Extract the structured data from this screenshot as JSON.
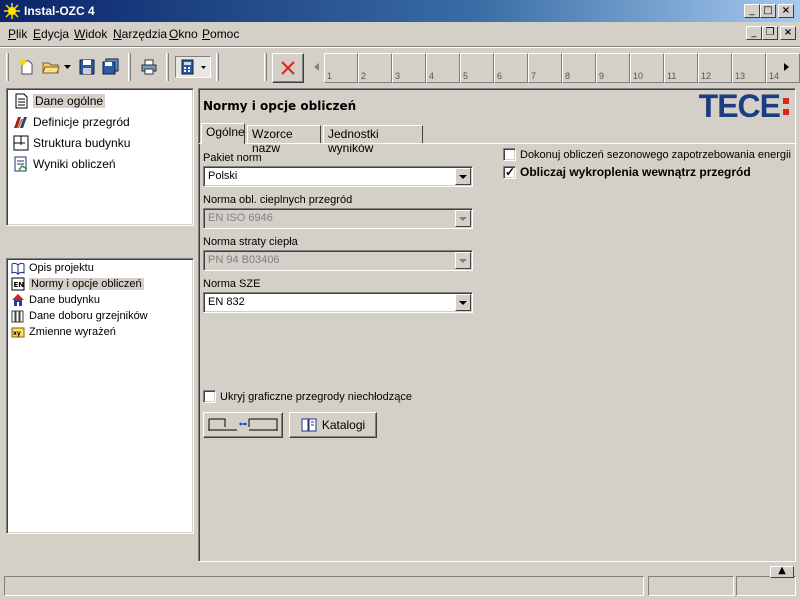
{
  "window": {
    "title": "Instal-OZC 4"
  },
  "menu": {
    "items": [
      {
        "label": "Plik",
        "key": "P",
        "rest": "lik"
      },
      {
        "label": "Edycja",
        "key": "E",
        "rest": "dycja"
      },
      {
        "label": "Widok",
        "key": "W",
        "rest": "idok"
      },
      {
        "label": "Narzędzia",
        "key": "N",
        "rest": "arzędzia"
      },
      {
        "label": "Okno",
        "key": "O",
        "rest": "kno"
      },
      {
        "label": "Pomoc",
        "key": "P",
        "rest": "omoc"
      }
    ]
  },
  "toolbar": {
    "strip_numbers": [
      "1",
      "2",
      "3",
      "4",
      "5",
      "6",
      "7",
      "8",
      "9",
      "10",
      "11",
      "12",
      "13",
      "14"
    ]
  },
  "nav_top": {
    "items": [
      "Dane ogólne",
      "Definicje przegród",
      "Struktura budynku",
      "Wyniki obliczeń"
    ]
  },
  "nav_bottom": {
    "items": [
      "Opis projektu",
      "Normy i opcje obliczeń",
      "Dane budynku",
      "Dane doboru grzejników",
      "Zmienne wyrażeń"
    ]
  },
  "panel": {
    "title": "Normy i opcje obliczeń",
    "logo": "TECE",
    "tabs": [
      "Ogólne",
      "Wzorce nazw",
      "Jednostki wyników"
    ],
    "fields": [
      {
        "label": "Pakiet norm",
        "value": "Polski",
        "disabled": false
      },
      {
        "label": "Norma obl. cieplnych przegród",
        "value": "EN ISO 6946",
        "disabled": true
      },
      {
        "label": "Norma straty ciepła",
        "value": "PN 94 B03406",
        "disabled": true
      },
      {
        "label": "Norma SZE",
        "value": "EN 832",
        "disabled": false
      }
    ],
    "checkbox_seasonal": {
      "label": "Dokonuj obliczeń sezonowego zapotrzebowania energii",
      "checked": false
    },
    "checkbox_condensation": {
      "label": "Obliczaj wykroplenia wewnątrz przegród",
      "checked": true
    },
    "checkbox_hide": {
      "label": "Ukryj graficzne przegrody niechłodzące",
      "checked": false
    },
    "catalog_button": "Katalogi"
  },
  "colors": {
    "titlebar": "#0a246a",
    "logo_blue": "#1b3d82",
    "logo_red": "#e2231a",
    "face": "#d4d0c8"
  }
}
